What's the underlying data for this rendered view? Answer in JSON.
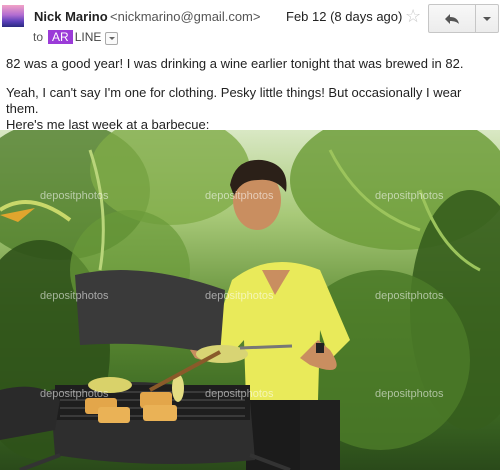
{
  "header": {
    "sender_name": "Nick Marino",
    "sender_email": "<nickmarino@gmail.com>",
    "to_label": "to",
    "recipient_highlight": "AR",
    "recipient_rest": "LINE",
    "date": "Feb 12 (8 days ago)",
    "star_icon": "star-icon",
    "reply_icon": "reply-icon",
    "more_icon": "chevron-down-icon"
  },
  "body": {
    "paragraph1": "82 was a good year! I was drinking a wine earlier tonight that was brewed in 82.",
    "paragraph2_line1": "Yeah, I can't say I'm one for clothing. Pesky little things! But occasionally I wear them.",
    "paragraph2_line2": "Here's me last week at a barbecue:"
  },
  "photo": {
    "watermark": "depositphotos"
  },
  "colors": {
    "recipient_highlight": "#9b3bd8",
    "foliage": "#3d6a23",
    "shirt": "#e9ea5a",
    "grill": "#2e2e2e"
  }
}
